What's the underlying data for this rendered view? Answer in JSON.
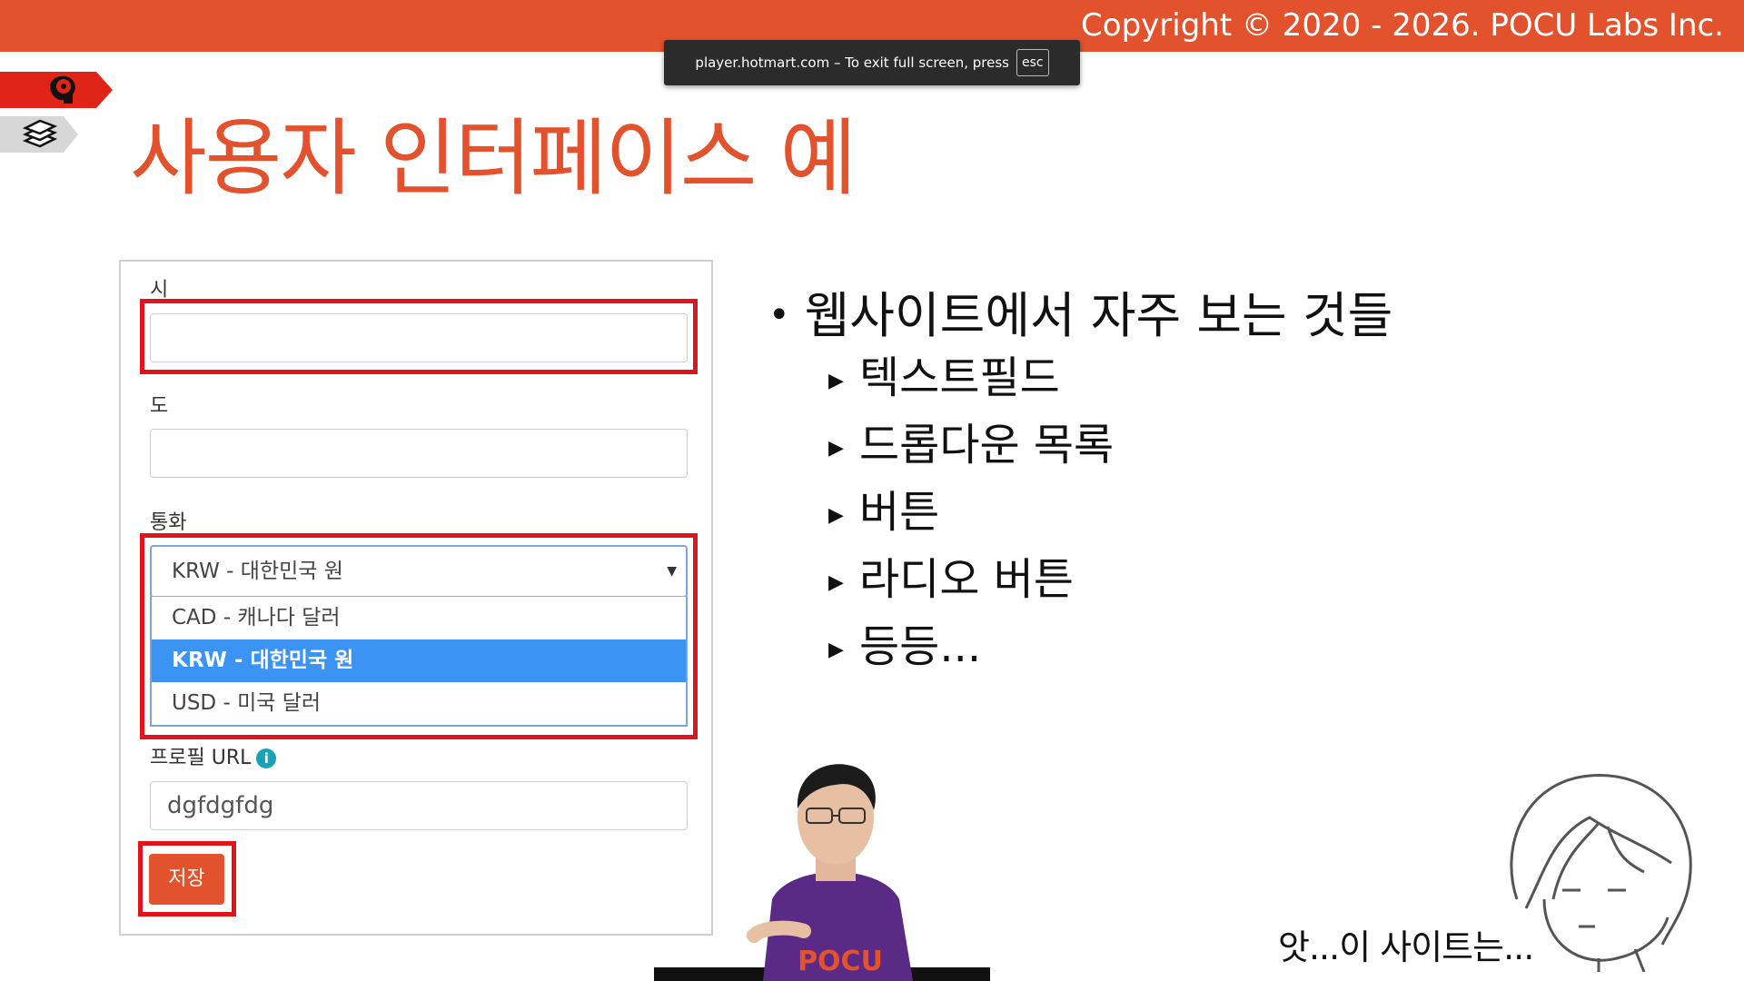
{
  "header": {
    "copyright": "Copyright © 2020 - 2026. POCU Labs Inc.",
    "accent_color": "#e2522d"
  },
  "fullscreen_notice": {
    "text": "player.hotmart.com – To exit full screen, press",
    "key": "esc"
  },
  "side_tags": {
    "icons": [
      "brain-icon",
      "books-icon"
    ]
  },
  "slide": {
    "title": "사용자 인터페이스 예"
  },
  "form": {
    "city_label": "시",
    "city_value": "",
    "province_label": "도",
    "province_value": "",
    "currency_label": "통화",
    "currency_selected": "KRW - 대한민국 원",
    "currency_options": [
      "CAD - 캐나다 달러",
      "KRW - 대한민국 원",
      "USD - 미국 달러"
    ],
    "currency_selected_index": 1,
    "profile_url_label": "프로필 URL",
    "profile_url_value": "dgfdgfdg",
    "save_label": "저장",
    "highlight_color": "#e0141c"
  },
  "bullets": {
    "main": "웹사이트에서 자주 보는 것들",
    "items": [
      "텍스트필드",
      "드롭다운 목록",
      "버튼",
      "라디오 버튼",
      "등등..."
    ]
  },
  "caption": "앗...이 사이트는..."
}
